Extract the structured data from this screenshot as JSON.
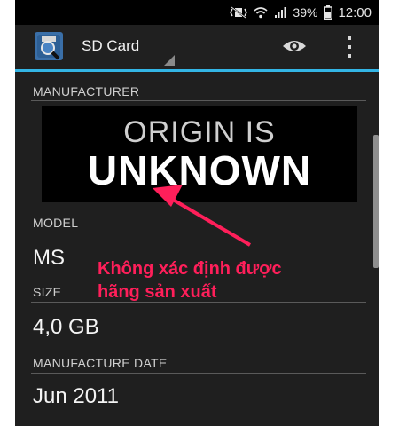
{
  "status_bar": {
    "icons": [
      "mute-vibrate-icon",
      "wifi-icon",
      "signal-icon",
      "battery-icon"
    ],
    "battery": "39%",
    "time": "12:00"
  },
  "app_bar": {
    "title": "SD Card",
    "accent_color": "#33b5e5",
    "actions": [
      "eye-icon",
      "overflow-menu-icon"
    ]
  },
  "details": {
    "manufacturer_label": "MANUFACTURER",
    "banner_line1": "ORIGIN IS",
    "banner_line2": "UNKNOWN",
    "model_label": "MODEL",
    "model_value": "MS",
    "size_label": "SIZE",
    "size_value": "4,0 GB",
    "date_label": "MANUFACTURE DATE",
    "date_value": "Jun 2011"
  },
  "annotation": {
    "line1": "Không xác định được",
    "line2": "hãng sản xuất",
    "color": "#ff1f5a"
  }
}
